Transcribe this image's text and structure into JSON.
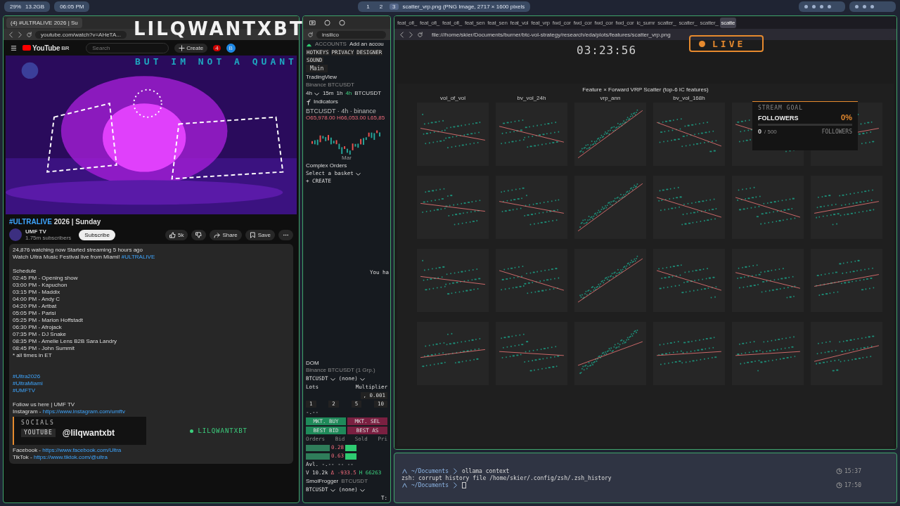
{
  "top_bar": {
    "system_stats": [
      "29%",
      "13.2GB"
    ],
    "clock": "06:05 PM",
    "workspaces": [
      {
        "label": "1",
        "selected": false
      },
      {
        "label": "2",
        "selected": false
      },
      {
        "label": "3",
        "selected": true
      }
    ],
    "window_title": "scatter_vrp.png (PNG Image, 2717 × 1600 pixels"
  },
  "youtube_window": {
    "tab_title": "(4) #ULTRALIVE 2026 | Su",
    "url": "youtube.com/watch?v=AHeTA...",
    "logo": "YouTube",
    "logo_region": "BR",
    "search_placeholder": "Search",
    "create": "Create",
    "notifications": "4",
    "avatar": "B",
    "title_tag": "#ULTRALIVE",
    "title_rest": " 2026 | Sunday",
    "channel": "UMF TV",
    "subscribers": "1.75m subscribers",
    "subscribe": "Subscribe",
    "likes": "5k",
    "share": "Share",
    "save": "Save",
    "description": [
      {
        "kind": "text",
        "text": "24,876 watching now  Started streaming 5 hours ago"
      },
      {
        "kind": "text",
        "text": "Watch Ultra Music Festival live from Miami! ",
        "link": "#ULTRALIVE"
      },
      {
        "kind": "gap"
      },
      {
        "kind": "text",
        "text": "Schedule"
      },
      {
        "kind": "text",
        "text": "02:45 PM - Opening show"
      },
      {
        "kind": "text",
        "text": "03:00 PM - Kapuchon"
      },
      {
        "kind": "text",
        "text": "03:15 PM - Maddix"
      },
      {
        "kind": "text",
        "text": "04:00 PM - Andy C"
      },
      {
        "kind": "text",
        "text": "04:20 PM - Artbat"
      },
      {
        "kind": "text",
        "text": "05:05 PM - Parisi"
      },
      {
        "kind": "text",
        "text": "05:25 PM - Marlon Hoffstadt"
      },
      {
        "kind": "text",
        "text": "06:30 PM - Afrojack"
      },
      {
        "kind": "text",
        "text": "07:35 PM - DJ Snake"
      },
      {
        "kind": "text",
        "text": "08:35 PM - Amelie Lens B2B Sara Landry"
      },
      {
        "kind": "text",
        "text": "08:45 PM - John Summit"
      },
      {
        "kind": "text",
        "text": "* all times in ET"
      },
      {
        "kind": "gap"
      },
      {
        "kind": "gap"
      },
      {
        "kind": "link",
        "link": "#Ultra2026"
      },
      {
        "kind": "link",
        "link": "#UltraMiami"
      },
      {
        "kind": "link",
        "link": "#UMFTV"
      },
      {
        "kind": "gap"
      },
      {
        "kind": "text",
        "text": "Follow us here | UMF TV"
      },
      {
        "kind": "text",
        "text": "Instagram - ",
        "link": "https://www.instagram.com/umftv"
      }
    ],
    "description_after": [
      {
        "kind": "text",
        "text": "Facebook - ",
        "link": "https://www.facebook.com/Ultra"
      },
      {
        "kind": "text",
        "text": "TikTok - ",
        "link": "https://www.tiktok.com/@ultra"
      }
    ]
  },
  "trading_window": {
    "url": "insilico",
    "accounts": "ACCOUNTS",
    "add_account": "Add an accou",
    "toolbar": [
      "HOTKEYS",
      "PRIVACY",
      "DESIGNER",
      "SOUND"
    ],
    "main_tab": "Main",
    "chart_source": "TradingView",
    "chart_symbol": "Binance BTCUSDT",
    "interval": "4h",
    "intervals": [
      {
        "label": "15m",
        "selected": false
      },
      {
        "label": "1h",
        "selected": false
      },
      {
        "label": "4h",
        "selected": true
      }
    ],
    "symbol": "BTCUSDT",
    "indicators": "Indicators",
    "chart_title": "BTCUSDT · 4h · binance",
    "ohlc": "O65,978.00 H66,053.00 L65,85",
    "x_label": "Mar",
    "complex_orders": "Complex Orders",
    "basket": "Select a basket",
    "create": "+ CREATE",
    "notice": "You ha",
    "dom": "DOM",
    "dom_symbol": "Binance BTCUSDT (1 Grp.)",
    "account_symbol": "BTCUSDT",
    "account_none": "(none)",
    "lots": "Lots",
    "multiplier": "Multiplier",
    "multiplier_value": ", 0.001",
    "lot_sizes": [
      "1",
      "2",
      "5",
      "10"
    ],
    "dash": "-.--",
    "buy": "MKT. BUY",
    "sell": "MKT. SEL",
    "best_bid": "BEST BID",
    "best_ask": "BEST AS",
    "columns": [
      "Orders",
      "Bid",
      "Sold",
      "Pri"
    ],
    "sold": [
      "0.28",
      "0.63"
    ],
    "avl": "Avl. -.-- -- --",
    "volume": "V 10.2k",
    "delta": "Δ -933.5",
    "high": "H 66263",
    "account2": "SmolFrogger",
    "account2_symbol": "BTCUSDT",
    "account2_dropdown": "BTCUSDT",
    "account2_none": "(none)",
    "footer": "T:"
  },
  "image_window": {
    "tabs": [
      {
        "label": "feat_ofi_",
        "selected": false
      },
      {
        "label": "feat_ofi_",
        "selected": false
      },
      {
        "label": "feat_ofi_",
        "selected": false
      },
      {
        "label": "feat_sen",
        "selected": false
      },
      {
        "label": "feat_sen",
        "selected": false
      },
      {
        "label": "feat_vol",
        "selected": false
      },
      {
        "label": "feat_vrp",
        "selected": false
      },
      {
        "label": "fwd_cor",
        "selected": false
      },
      {
        "label": "fwd_cor",
        "selected": false
      },
      {
        "label": "fwd_cor",
        "selected": false
      },
      {
        "label": "fwd_cor",
        "selected": false
      },
      {
        "label": "ic_sumr",
        "selected": false
      },
      {
        "label": "scatter_",
        "selected": false
      },
      {
        "label": "scatter_",
        "selected": false
      },
      {
        "label": "scatter_",
        "selected": false
      },
      {
        "label": "scatte",
        "selected": true
      }
    ],
    "url": "file:///home/skier/Documents/burner/btc-vol-strategy/research/eda/plots/features/scatter_vrp.png",
    "figure_title": "Feature × Forward VRP Scatter (top-6 IC features)",
    "column_titles": [
      "vol_of_vol",
      "bv_vol_24h",
      "vrp_ann",
      "bv_vol_168h"
    ]
  },
  "terminal": {
    "lines": [
      {
        "kind": "prompt",
        "path": "~/Documents",
        "command": "ollama context",
        "time": "15:37"
      },
      {
        "kind": "output",
        "text": "zsh: corrupt history file /home/skier/.config/zsh/.zsh_history"
      },
      {
        "kind": "prompt",
        "path": "~/Documents",
        "time": "17:50"
      }
    ]
  },
  "overlays": {
    "brand": "LILQWANTXBT",
    "tagline": "BUT IM NOT A QUANT",
    "timer": "03:23:56",
    "live": "LIVE",
    "goal": {
      "label": "STREAM GOAL",
      "title": "FOLLOWERS",
      "percent": "0%",
      "level": 0,
      "count": "0",
      "total": "/ 500",
      "unit": "FOLLOWERS"
    },
    "socials": "SOCIALS",
    "socials_platform": "YOUTUBE",
    "socials_handle": "@lilqwantxbt",
    "handle_tag": "LILQWANTXBT"
  }
}
